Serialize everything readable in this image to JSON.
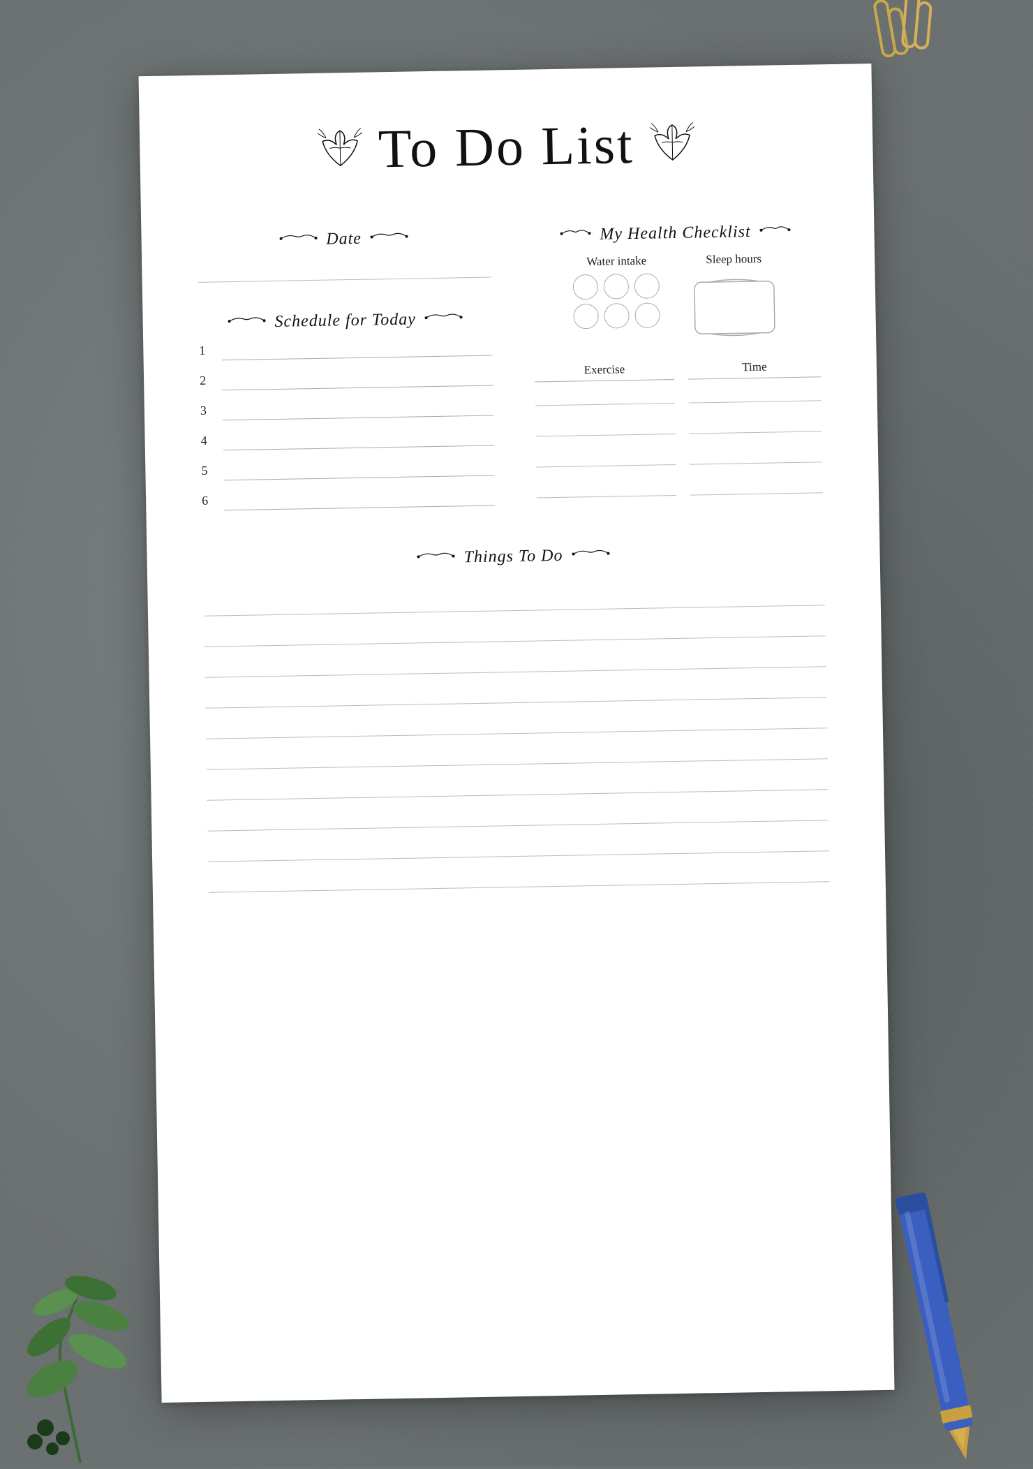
{
  "title": "To Do List",
  "sections": {
    "date": {
      "label": "Date"
    },
    "schedule": {
      "label": "Schedule for Today",
      "items": [
        1,
        2,
        3,
        4,
        5,
        6
      ]
    },
    "health": {
      "label": "My Health Checklist",
      "water_intake_label": "Water intake",
      "sleep_hours_label": "Sleep hours",
      "circles_count": 6,
      "exercise_label": "Exercise",
      "time_label": "Time",
      "exercise_rows": 4
    },
    "things": {
      "label": "Things To Do",
      "lines_count": 10
    }
  },
  "decorations": {
    "leaf_left": "❧",
    "leaf_right": "❧",
    "branch_decor": "⁂"
  }
}
